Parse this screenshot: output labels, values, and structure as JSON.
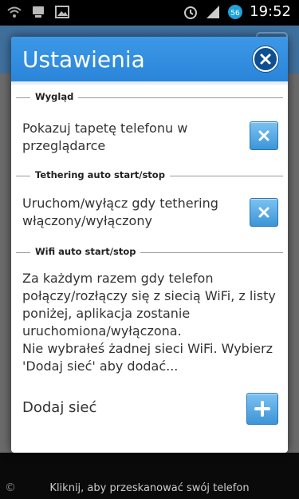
{
  "status_bar": {
    "time": "19:52",
    "left_icons": [
      "wifi-question-icon",
      "device-icon",
      "image-icon"
    ],
    "right_icons": [
      "alarm-icon",
      "signal-icon",
      "data-56-icon"
    ]
  },
  "background_app": {
    "footer_text": "Kliknij, aby przeskanować swój telefon"
  },
  "dialog": {
    "title": "Ustawienia",
    "sections": [
      {
        "header": "Wygląd",
        "item_text": "Pokazuj tapetę telefonu w przeglądarce"
      },
      {
        "header": "Tethering auto start/stop",
        "item_text": "Uruchom/wyłącz gdy tethering włączony/wyłączony"
      },
      {
        "header": "Wifi auto start/stop",
        "description": "Za każdym razem gdy telefon połączy/rozłączy się z siecią WiFi, z listy poniżej, aplikacja zostanie uruchomiona/wyłączona.\nNie wybrałeś żadnej sieci WiFi. Wybierz 'Dodaj sieć' aby dodać...",
        "add_label": "Dodaj sieć"
      }
    ]
  },
  "colors": {
    "accent": "#2a85da",
    "close_button": "#0e4f90",
    "toggle_button": "#3c95d8"
  }
}
